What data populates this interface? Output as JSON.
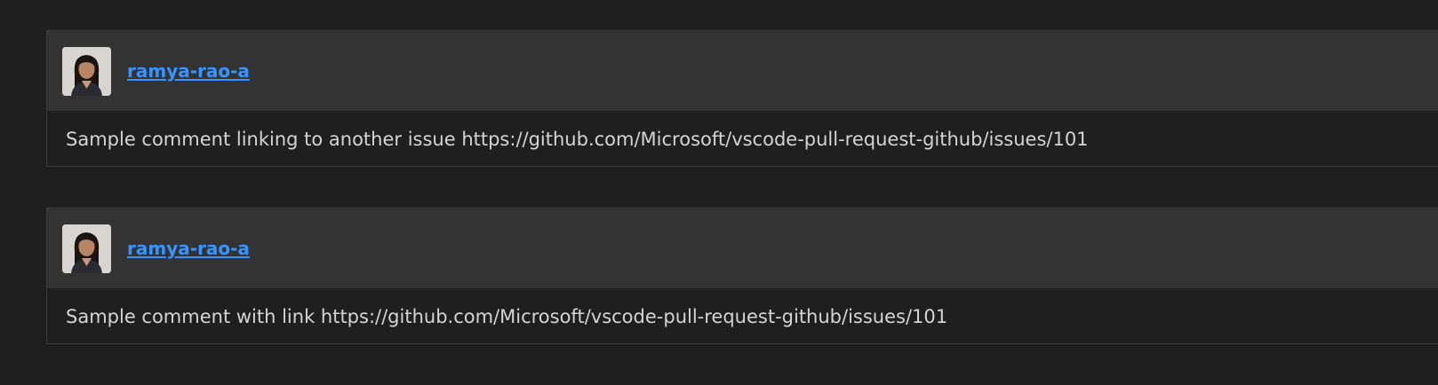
{
  "comments": [
    {
      "author": "ramya-rao-a",
      "body": "Sample comment linking to another issue https://github.com/Microsoft/vscode-pull-request-github/issues/101"
    },
    {
      "author": "ramya-rao-a",
      "body": "Sample comment with link https://github.com/Microsoft/vscode-pull-request-github/issues/101"
    }
  ],
  "colors": {
    "background": "#1f1f1f",
    "header_background": "#333333",
    "link": "#3794ff",
    "text": "#d4d4d4"
  },
  "icons": {
    "avatar": "user-avatar-photo"
  }
}
